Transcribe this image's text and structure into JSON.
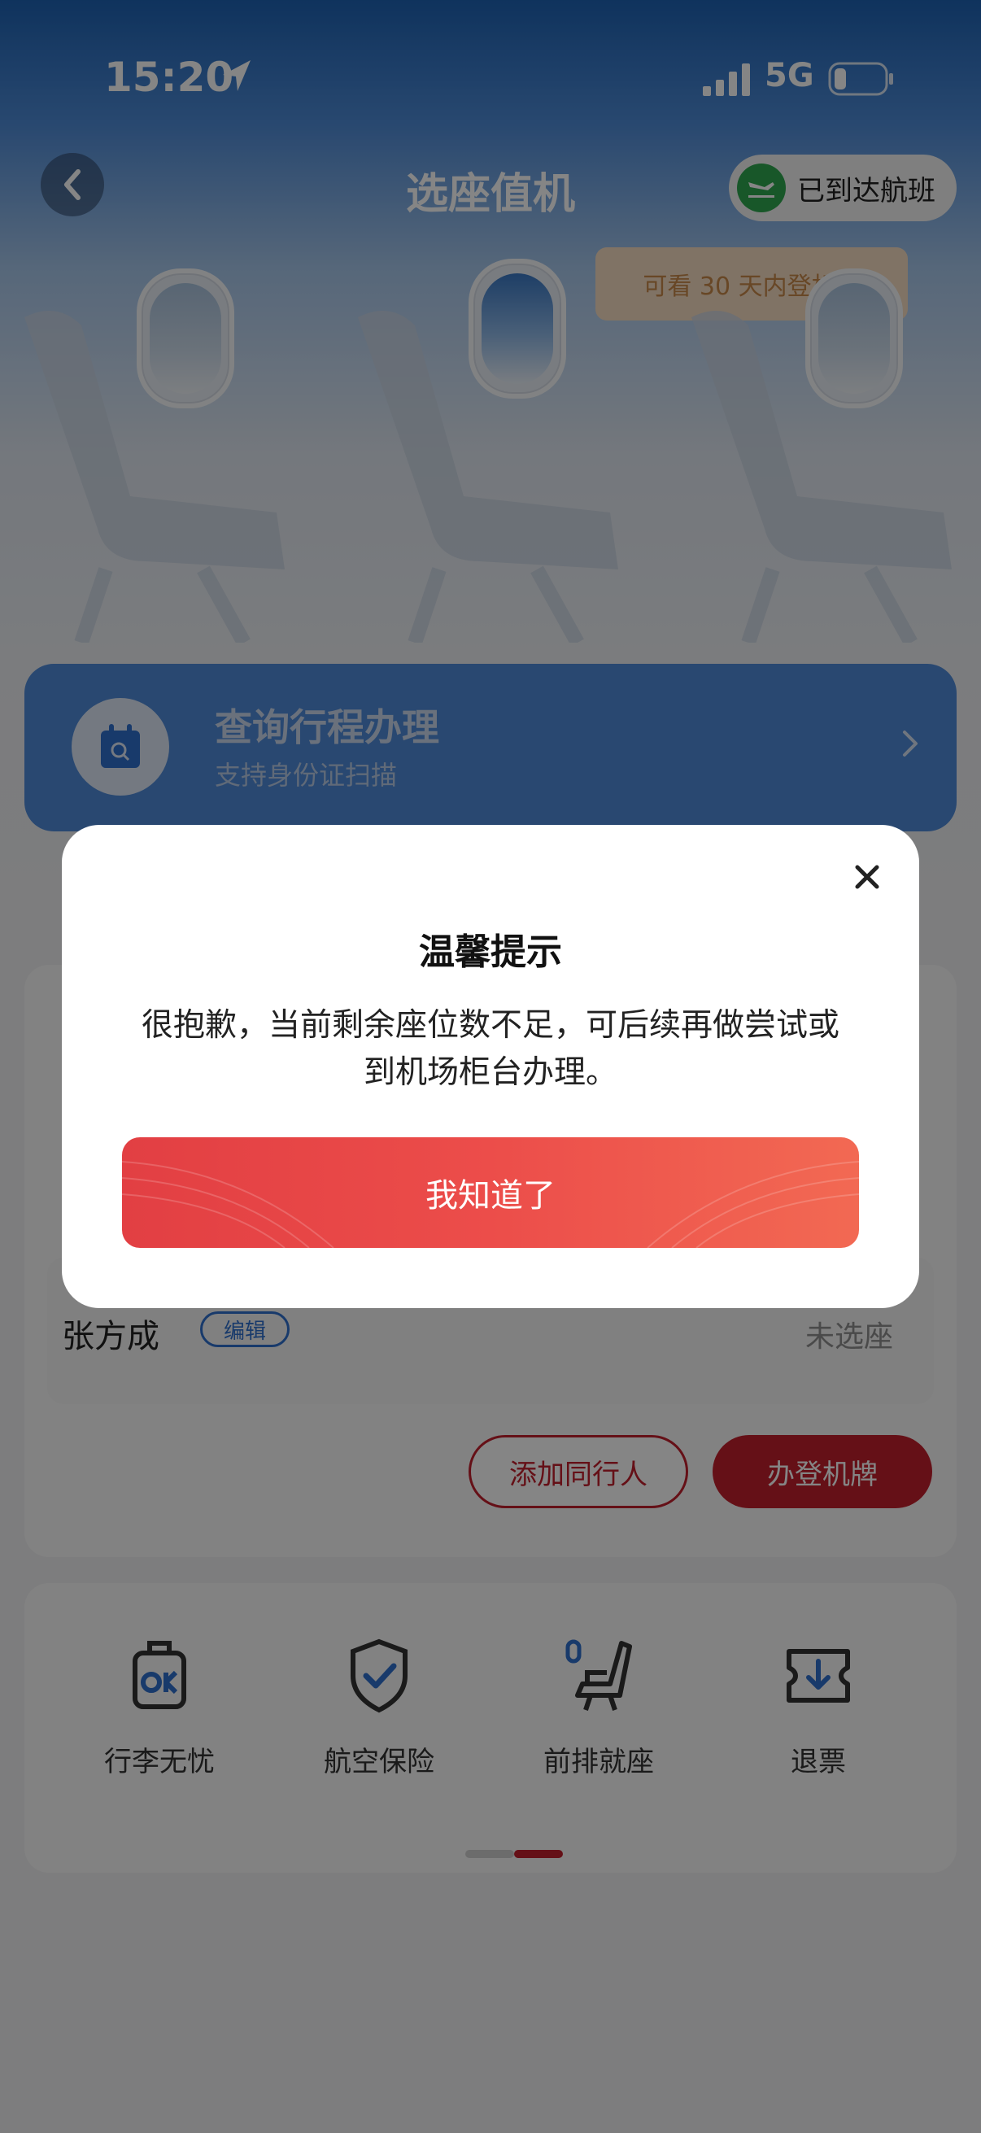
{
  "status_bar": {
    "time": "15:20",
    "network": "5G"
  },
  "header": {
    "title": "选座值机",
    "arrived_button": "已到达航班",
    "tooltip": "可看 30 天内登机牌"
  },
  "query_card": {
    "title": "查询行程办理",
    "subtitle": "支持身份证扫描"
  },
  "passenger": {
    "name": "张方成",
    "edit_label": "编辑",
    "seat_status": "未选座"
  },
  "actions": {
    "add_companion": "添加同行人",
    "get_boarding_pass": "办登机牌"
  },
  "services": [
    {
      "label": "行李无忧",
      "icon": "luggage-icon"
    },
    {
      "label": "航空保险",
      "icon": "shield-check-icon"
    },
    {
      "label": "前排就座",
      "icon": "seat-icon"
    },
    {
      "label": "退票",
      "icon": "refund-ticket-icon"
    }
  ],
  "dialog": {
    "title": "温馨提示",
    "message": "很抱歉，当前剩余座位数不足，可后续再做尝试或到机场柜台办理。",
    "confirm": "我知道了"
  },
  "colors": {
    "brand_red": "#c21f2c",
    "dialog_button": "#ec4d4a",
    "accent_blue": "#2f6fce"
  }
}
